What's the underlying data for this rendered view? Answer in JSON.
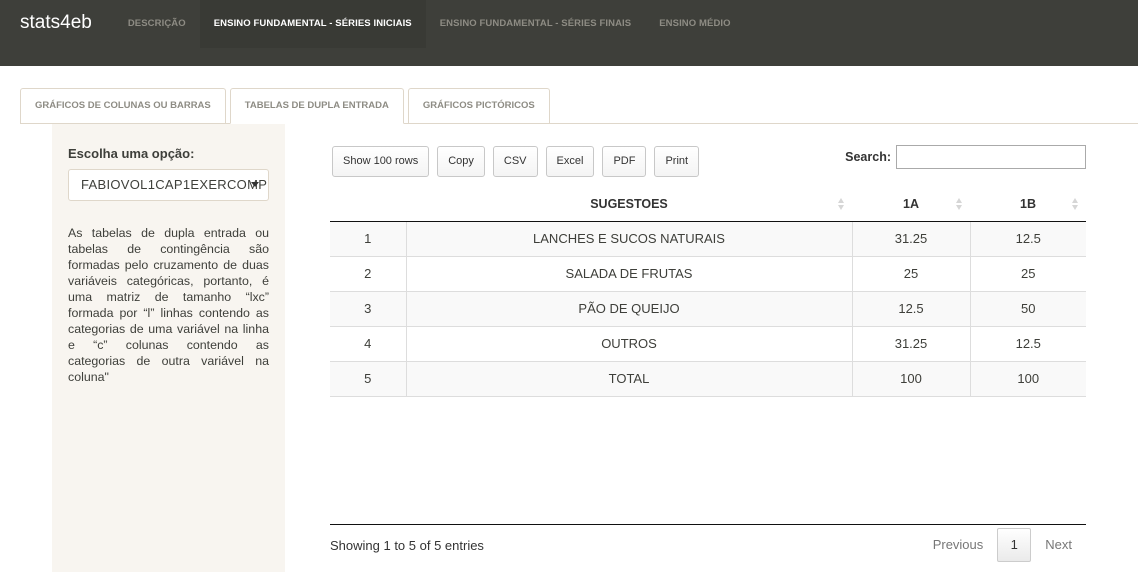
{
  "navbar": {
    "brand": "stats4eb",
    "links": [
      {
        "label": "DESCRIÇÃO"
      },
      {
        "label": "ENSINO FUNDAMENTAL - SÉRIES INICIAIS"
      },
      {
        "label": "ENSINO FUNDAMENTAL - SÉRIES FINAIS"
      },
      {
        "label": "ENSINO MÉDIO"
      }
    ]
  },
  "tabs": [
    {
      "label": "GRÁFICOS DE COLUNAS OU BARRAS"
    },
    {
      "label": "TABELAS DE DUPLA ENTRADA"
    },
    {
      "label": "GRÁFICOS PICTÓRICOS"
    }
  ],
  "sidebar": {
    "label": "Escolha uma opção:",
    "selected": "FABIOVOL1CAP1EXERCOMP",
    "description": "As tabelas de dupla entrada ou tabelas de contingência são formadas pelo cruzamento de duas variáveis categóricas, portanto, é uma matriz de tamanho “lxc” formada por “l” linhas contendo as categorias de uma variável na linha e “c” colunas contendo as categorias de outra variável na coluna\""
  },
  "toolbar": {
    "buttons": [
      "Show 100 rows",
      "Copy",
      "CSV",
      "Excel",
      "PDF",
      "Print"
    ],
    "search_label": "Search:"
  },
  "table": {
    "headers": [
      "",
      "SUGESTOES",
      "1A",
      "1B"
    ],
    "rows": [
      [
        "1",
        "LANCHES E SUCOS NATURAIS",
        "31.25",
        "12.5"
      ],
      [
        "2",
        "SALADA DE FRUTAS",
        "25",
        "25"
      ],
      [
        "3",
        "PÃO DE QUEIJO",
        "12.5",
        "50"
      ],
      [
        "4",
        "OUTROS",
        "31.25",
        "12.5"
      ],
      [
        "5",
        "TOTAL",
        "100",
        "100"
      ]
    ]
  },
  "footer": {
    "info": "Showing 1 to 5 of 5 entries",
    "previous": "Previous",
    "page": "1",
    "next": "Next"
  },
  "colors": {
    "navbar_bg": "#3e3f3a",
    "sidebar_bg": "#f8f5f0",
    "muted_text": "#8e8c84"
  }
}
